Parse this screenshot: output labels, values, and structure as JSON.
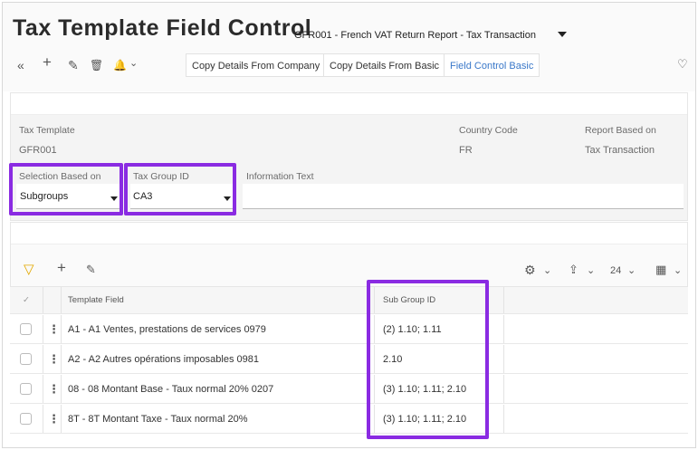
{
  "header": {
    "title": "Tax Template Field Control",
    "subtitle": "GFR001 - French VAT Return Report - Tax Transaction"
  },
  "toolbar": {
    "back_icon": "«",
    "add_icon": "+",
    "edit_icon": "✎",
    "delete_icon": "🗑",
    "bell_icon": "🔔",
    "bell_caret": "⌄",
    "buttons": [
      "Copy Details From Company",
      "Copy Details From Basic",
      "Field Control Basic"
    ],
    "heart_icon": "♡"
  },
  "form": {
    "tax_template_label": "Tax Template",
    "tax_template_value": "GFR001",
    "country_code_label": "Country Code",
    "country_code_value": "FR",
    "report_based_on_label": "Report Based on",
    "report_based_on_value": "Tax Transaction",
    "selection_based_on_label": "Selection Based on",
    "selection_based_on_value": "Subgroups",
    "tax_group_id_label": "Tax Group ID",
    "tax_group_id_value": "CA3",
    "information_text_label": "Information Text",
    "information_text_value": ""
  },
  "list_toolbar": {
    "filter_icon": "▽",
    "add_icon": "+",
    "edit_icon": "✎",
    "settings_icon": "⚙",
    "settings_caret": "⌄",
    "export_icon": "⇪",
    "export_caret": "⌄",
    "page_size": "24",
    "page_size_caret": "⌄",
    "columns_icon": "▦",
    "columns_caret": "⌄"
  },
  "table": {
    "select_all_icon": "✓",
    "columns": [
      "Template Field",
      "Sub Group ID"
    ],
    "rows": [
      {
        "template_field": "A1 - A1 Ventes, prestations de services 0979",
        "sub_group_id": "(2) 1.10; 1.11"
      },
      {
        "template_field": "A2 - A2 Autres opérations imposables 0981",
        "sub_group_id": "2.10"
      },
      {
        "template_field": "08 - 08 Montant Base - Taux normal 20% 0207",
        "sub_group_id": "(3) 1.10; 1.11; 2.10"
      },
      {
        "template_field": "8T - 8T Montant Taxe - Taux normal 20%",
        "sub_group_id": "(3) 1.10; 1.11; 2.10"
      }
    ],
    "row_menu_icon": "⋮"
  },
  "colors": {
    "highlight": "#8a2be2",
    "active_link": "#3a78c9",
    "filter_icon": "#e2a800"
  }
}
